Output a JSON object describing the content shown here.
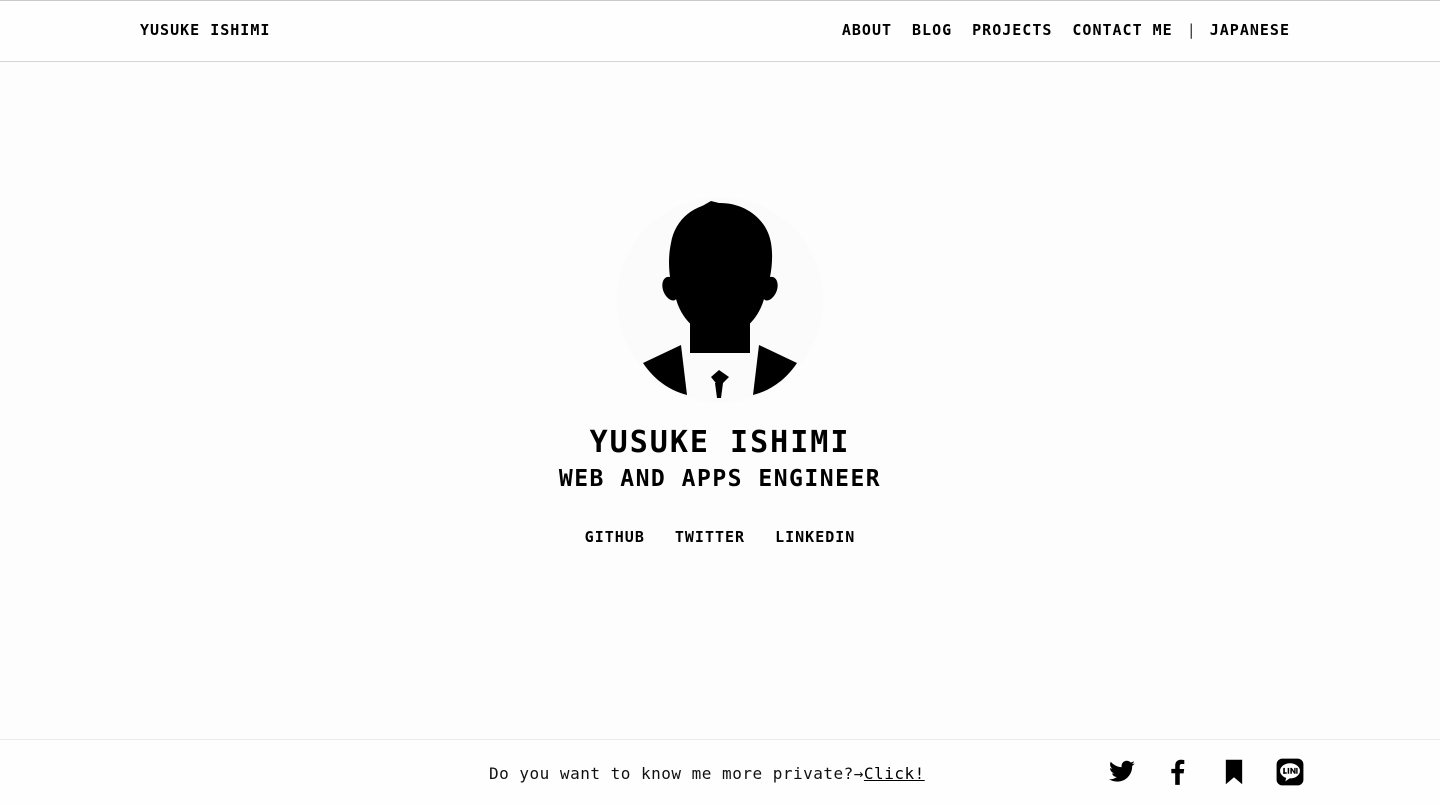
{
  "header": {
    "brand": "YUSUKE ISHIMI",
    "nav": [
      "ABOUT",
      "BLOG",
      "PROJECTS",
      "CONTACT ME"
    ],
    "separator": "|",
    "language": "JAPANESE"
  },
  "hero": {
    "avatar_icon": "person-silhouette-icon",
    "name": "YUSUKE ISHIMI",
    "title": "WEB AND APPS ENGINEER",
    "links": [
      "GITHUB",
      "TWITTER",
      "LINKEDIN"
    ]
  },
  "footer": {
    "message": "Do you want to know me more private?→",
    "link_text": "Click!",
    "social_icons": [
      "twitter-icon",
      "facebook-icon",
      "bookmark-icon",
      "line-icon"
    ]
  }
}
